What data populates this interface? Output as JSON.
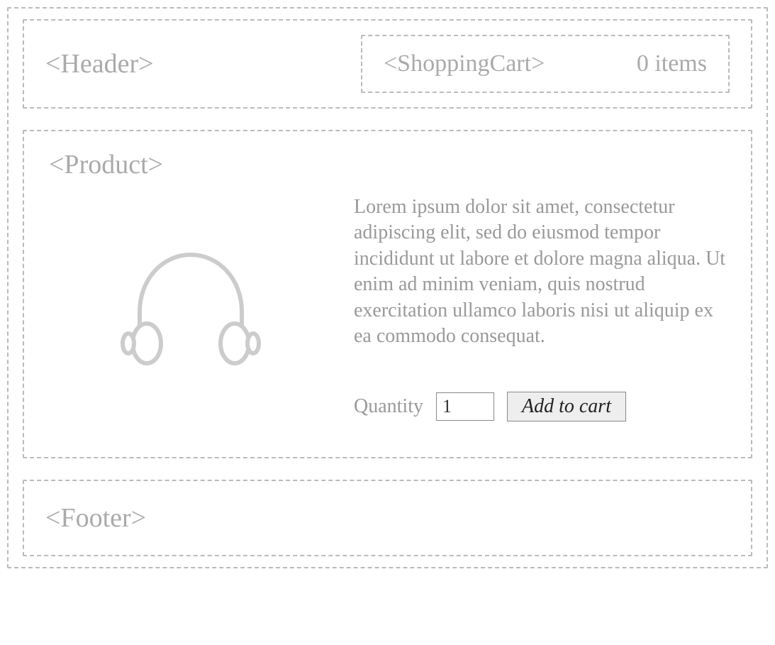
{
  "header": {
    "label": "<Header>",
    "cart": {
      "label": "<ShoppingCart>",
      "count_text": "0 items"
    }
  },
  "product": {
    "label": "<Product>",
    "description": "Lorem ipsum dolor sit amet, consectetur adipiscing elit, sed do eiusmod tempor incididunt ut labore et dolore magna aliqua. Ut enim ad minim veniam, quis nostrud exercitation ullamco laboris nisi ut aliquip ex ea commodo consequat.",
    "quantity_label": "Quantity",
    "quantity_value": "1",
    "add_button_label": "Add to cart",
    "image_icon": "headphones-icon"
  },
  "footer": {
    "label": "<Footer>"
  }
}
